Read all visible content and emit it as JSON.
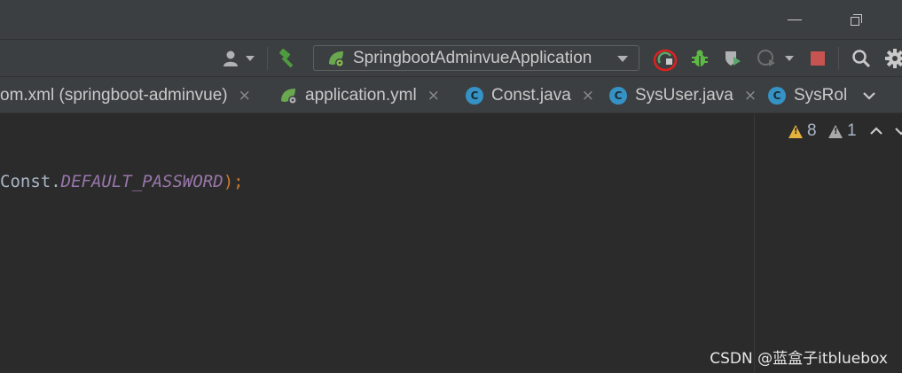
{
  "window": {
    "minimize_label": "—",
    "restore_label": "❐"
  },
  "toolbar": {
    "run_configuration": "SpringbootAdminvueApplication",
    "icons": [
      "user-icon",
      "build-hammer-icon",
      "spring-boot-icon",
      "rerun-icon",
      "debug-bug-icon",
      "coverage-icon",
      "profiler-icon",
      "stop-icon",
      "search-icon",
      "settings-gear-icon"
    ],
    "colors": {
      "build": "#4e9a3e",
      "debug": "#5fb845",
      "stop": "#c75450",
      "highlight_circle": "#e02020"
    }
  },
  "tabs": [
    {
      "label": "om.xml (springboot-adminvue)",
      "close": "×"
    },
    {
      "label": "application.yml",
      "close": "×"
    },
    {
      "label": "Const.java",
      "close": "×"
    },
    {
      "label": "SysUser.java",
      "close": "×"
    },
    {
      "label": "SysRol",
      "close": ""
    }
  ],
  "editor": {
    "code_class": "Const",
    "code_dot": ".",
    "code_constant": "DEFAULT_PASSWORD",
    "code_paren": ")",
    "code_semicolon": ";"
  },
  "inspections": {
    "warnings": "8",
    "weak_warnings": "1"
  },
  "watermark": "CSDN @蓝盒子itbluebox"
}
